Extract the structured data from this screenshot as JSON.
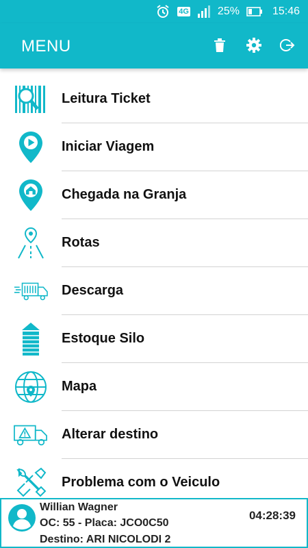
{
  "status_bar": {
    "network": "4G",
    "battery": "25%",
    "time": "15:46",
    "icons": [
      "alarm-icon",
      "signal-icon",
      "battery-icon"
    ]
  },
  "header": {
    "title": "MENU",
    "actions": [
      "trash-icon",
      "gear-icon",
      "logout-icon"
    ]
  },
  "menu": {
    "items": [
      {
        "label": "Leitura Ticket",
        "icon": "barcode-search-icon"
      },
      {
        "label": "Iniciar Viagem",
        "icon": "map-pin-play-icon"
      },
      {
        "label": "Chegada na Granja",
        "icon": "map-pin-home-icon"
      },
      {
        "label": "Rotas",
        "icon": "route-icon"
      },
      {
        "label": "Descarga",
        "icon": "truck-unload-icon"
      },
      {
        "label": "Estoque Silo",
        "icon": "silo-icon"
      },
      {
        "label": "Mapa",
        "icon": "globe-pin-icon"
      },
      {
        "label": "Alterar destino",
        "icon": "truck-warning-icon"
      },
      {
        "label": "Problema com o Veiculo",
        "icon": "wrench-icon"
      }
    ]
  },
  "footer": {
    "driver_name": "Willian Wagner",
    "oc_line": "OC: 55 - Placa: JCO0C50",
    "destination_line": "Destino: ARI NICOLODI 2",
    "timer": "04:28:39"
  },
  "colors": {
    "primary": "#11b8c9",
    "text": "#111111",
    "divider": "#d2d2d2"
  }
}
